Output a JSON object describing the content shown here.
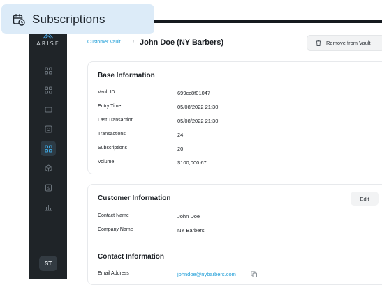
{
  "title_chip": {
    "label": "Subscriptions",
    "icon": "calendar-clock-icon"
  },
  "sidebar": {
    "logo_text": "ARISE",
    "items": [
      {
        "icon": "grid-icon",
        "active": false
      },
      {
        "icon": "grid-icon",
        "active": false
      },
      {
        "icon": "card-icon",
        "active": false
      },
      {
        "icon": "safe-icon",
        "active": false
      },
      {
        "icon": "grid-icon",
        "active": true
      },
      {
        "icon": "box-icon",
        "active": false
      },
      {
        "icon": "dollar-doc-icon",
        "active": false
      },
      {
        "icon": "bar-chart-icon",
        "active": false
      }
    ],
    "avatar_initials": "ST"
  },
  "header": {
    "breadcrumb_parent": "Customer Vault",
    "breadcrumb_sep": "/",
    "page_title": "John Doe (NY Barbers)",
    "remove_label": "Remove from Vault"
  },
  "base_info": {
    "title": "Base Information",
    "rows": [
      {
        "label": "Vault ID",
        "value": "699cc8f01047"
      },
      {
        "label": "Entry Time",
        "value": "05/08/2022 21:30"
      },
      {
        "label": "Last Transaction",
        "value": "05/08/2022 21:30"
      },
      {
        "label": "Transactions",
        "value": "24"
      },
      {
        "label": "Subscriptions",
        "value": "20"
      },
      {
        "label": "Volume",
        "value": "$100,000.67"
      }
    ]
  },
  "customer_info": {
    "title": "Customer Information",
    "edit_label": "Edit",
    "rows": [
      {
        "label": "Contact Name",
        "value": "John Doe"
      },
      {
        "label": "Company Name",
        "value": "NY Barbers"
      }
    ],
    "contact_title": "Contact Information",
    "email_label": "Email Address",
    "email_value": "johndoe@nybarbers.com"
  },
  "colors": {
    "accent": "#1f9ed8",
    "sidebar": "#1f2428",
    "chip": "#dcebf8"
  }
}
